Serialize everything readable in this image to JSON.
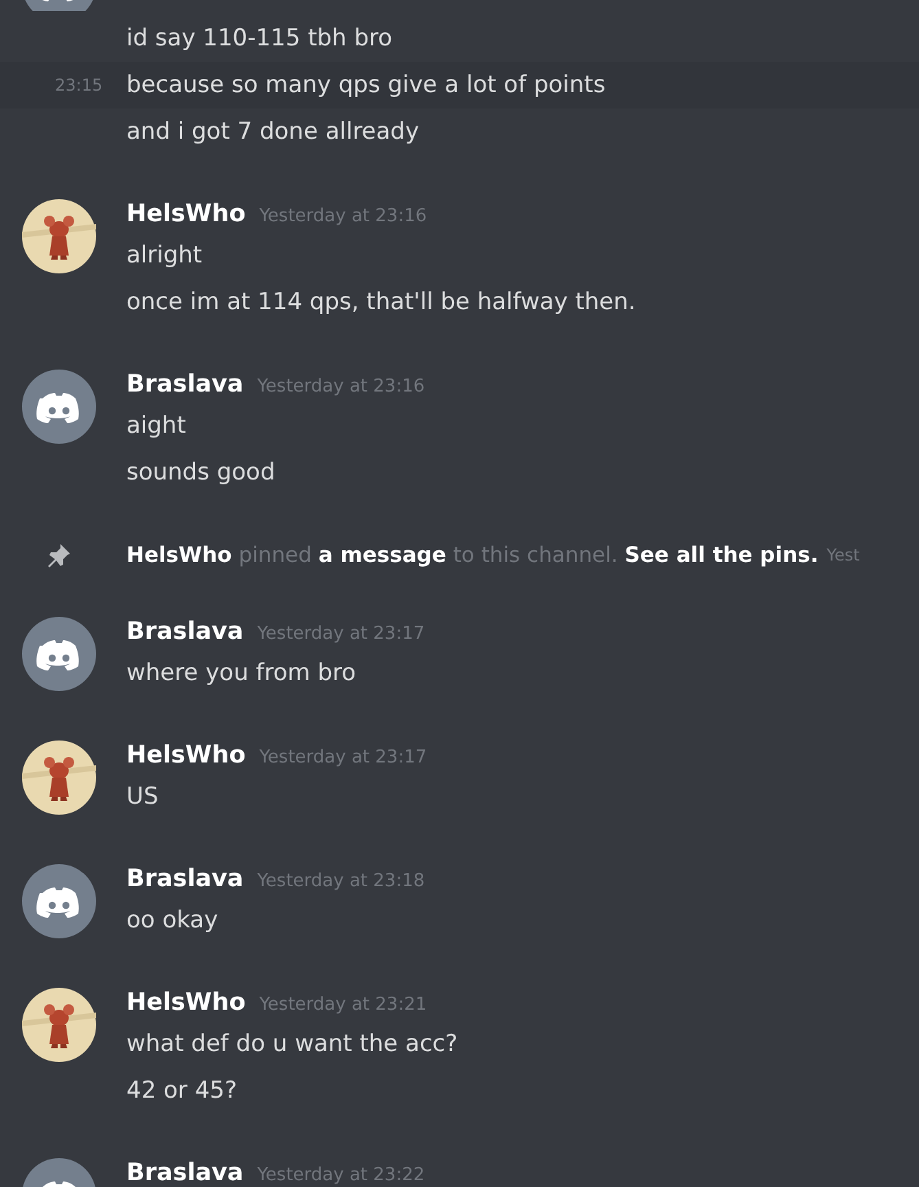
{
  "messages": [
    {
      "kind": "continuation",
      "avatar": {
        "kind": "default"
      },
      "lines": [
        {
          "text": "id say 110-115 tbh bro"
        },
        {
          "text": "because so many qps give a lot of points",
          "hovered": true,
          "time": "23:15"
        },
        {
          "text": "and i got 7 done allready"
        }
      ]
    },
    {
      "kind": "group",
      "author": "HelsWho",
      "avatar": {
        "kind": "image"
      },
      "timestamp": "Yesterday at 23:16",
      "lines": [
        {
          "text": "alright"
        },
        {
          "text": "once im at 114 qps, that'll be halfway then."
        }
      ]
    },
    {
      "kind": "group",
      "author": "Braslava",
      "avatar": {
        "kind": "default"
      },
      "timestamp": "Yesterday at 23:16",
      "lines": [
        {
          "text": "aight"
        },
        {
          "text": "sounds good"
        }
      ]
    },
    {
      "kind": "pin",
      "parts": [
        {
          "text": "HelsWho",
          "kind": "user"
        },
        {
          "text": "pinned",
          "kind": "plain"
        },
        {
          "text": "a message",
          "kind": "link"
        },
        {
          "text": "to this channel.",
          "kind": "plain"
        },
        {
          "text": "See all the pins.",
          "kind": "link"
        }
      ],
      "timestamp": "Yest"
    },
    {
      "kind": "group",
      "author": "Braslava",
      "avatar": {
        "kind": "default"
      },
      "timestamp": "Yesterday at 23:17",
      "lines": [
        {
          "text": "where you from bro"
        }
      ]
    },
    {
      "kind": "group",
      "author": "HelsWho",
      "avatar": {
        "kind": "image"
      },
      "timestamp": "Yesterday at 23:17",
      "lines": [
        {
          "text": "US"
        }
      ]
    },
    {
      "kind": "group",
      "author": "Braslava",
      "avatar": {
        "kind": "default"
      },
      "timestamp": "Yesterday at 23:18",
      "lines": [
        {
          "text": "oo okay"
        }
      ]
    },
    {
      "kind": "group",
      "author": "HelsWho",
      "avatar": {
        "kind": "image"
      },
      "timestamp": "Yesterday at 23:21",
      "lines": [
        {
          "text": "what def do u want the acc?"
        },
        {
          "text": "42 or 45?"
        }
      ]
    },
    {
      "kind": "group",
      "author": "Braslava",
      "avatar": {
        "kind": "default"
      },
      "timestamp": "Yesterday at 23:22"
    }
  ]
}
